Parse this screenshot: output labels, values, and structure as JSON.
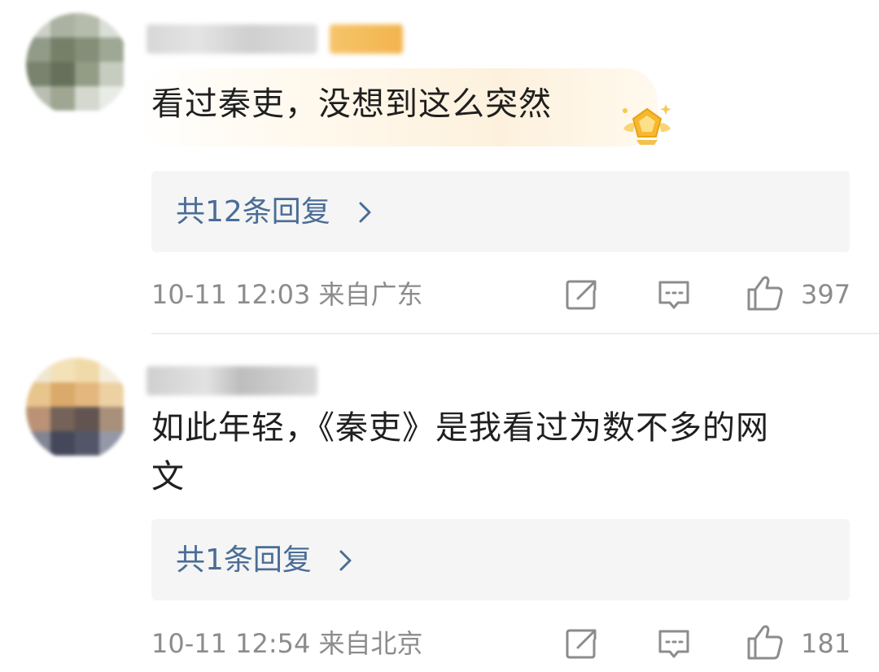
{
  "comments": [
    {
      "text": "看过秦吏，没想到这么突然",
      "replies_label": "共12条回复",
      "time_location": "10-11 12:03 来自广东",
      "like_count": "397"
    },
    {
      "text": "如此年轻，《秦吏》是我看过为数不多的网\n文",
      "replies_label": "共1条回复",
      "time_location": "10-11 12:54 来自北京",
      "like_count": "181"
    }
  ],
  "colors": {
    "reply_link": "#4a6d96",
    "meta_text": "#8c8c8c",
    "reply_bg": "#f5f5f5",
    "badge_gold": "#f5b82e"
  },
  "icons": {
    "share": "share-edit-icon",
    "comment": "comment-icon",
    "like": "thumbs-up-icon",
    "chevron": "chevron-right-icon",
    "badge": "gold-badge-icon"
  }
}
